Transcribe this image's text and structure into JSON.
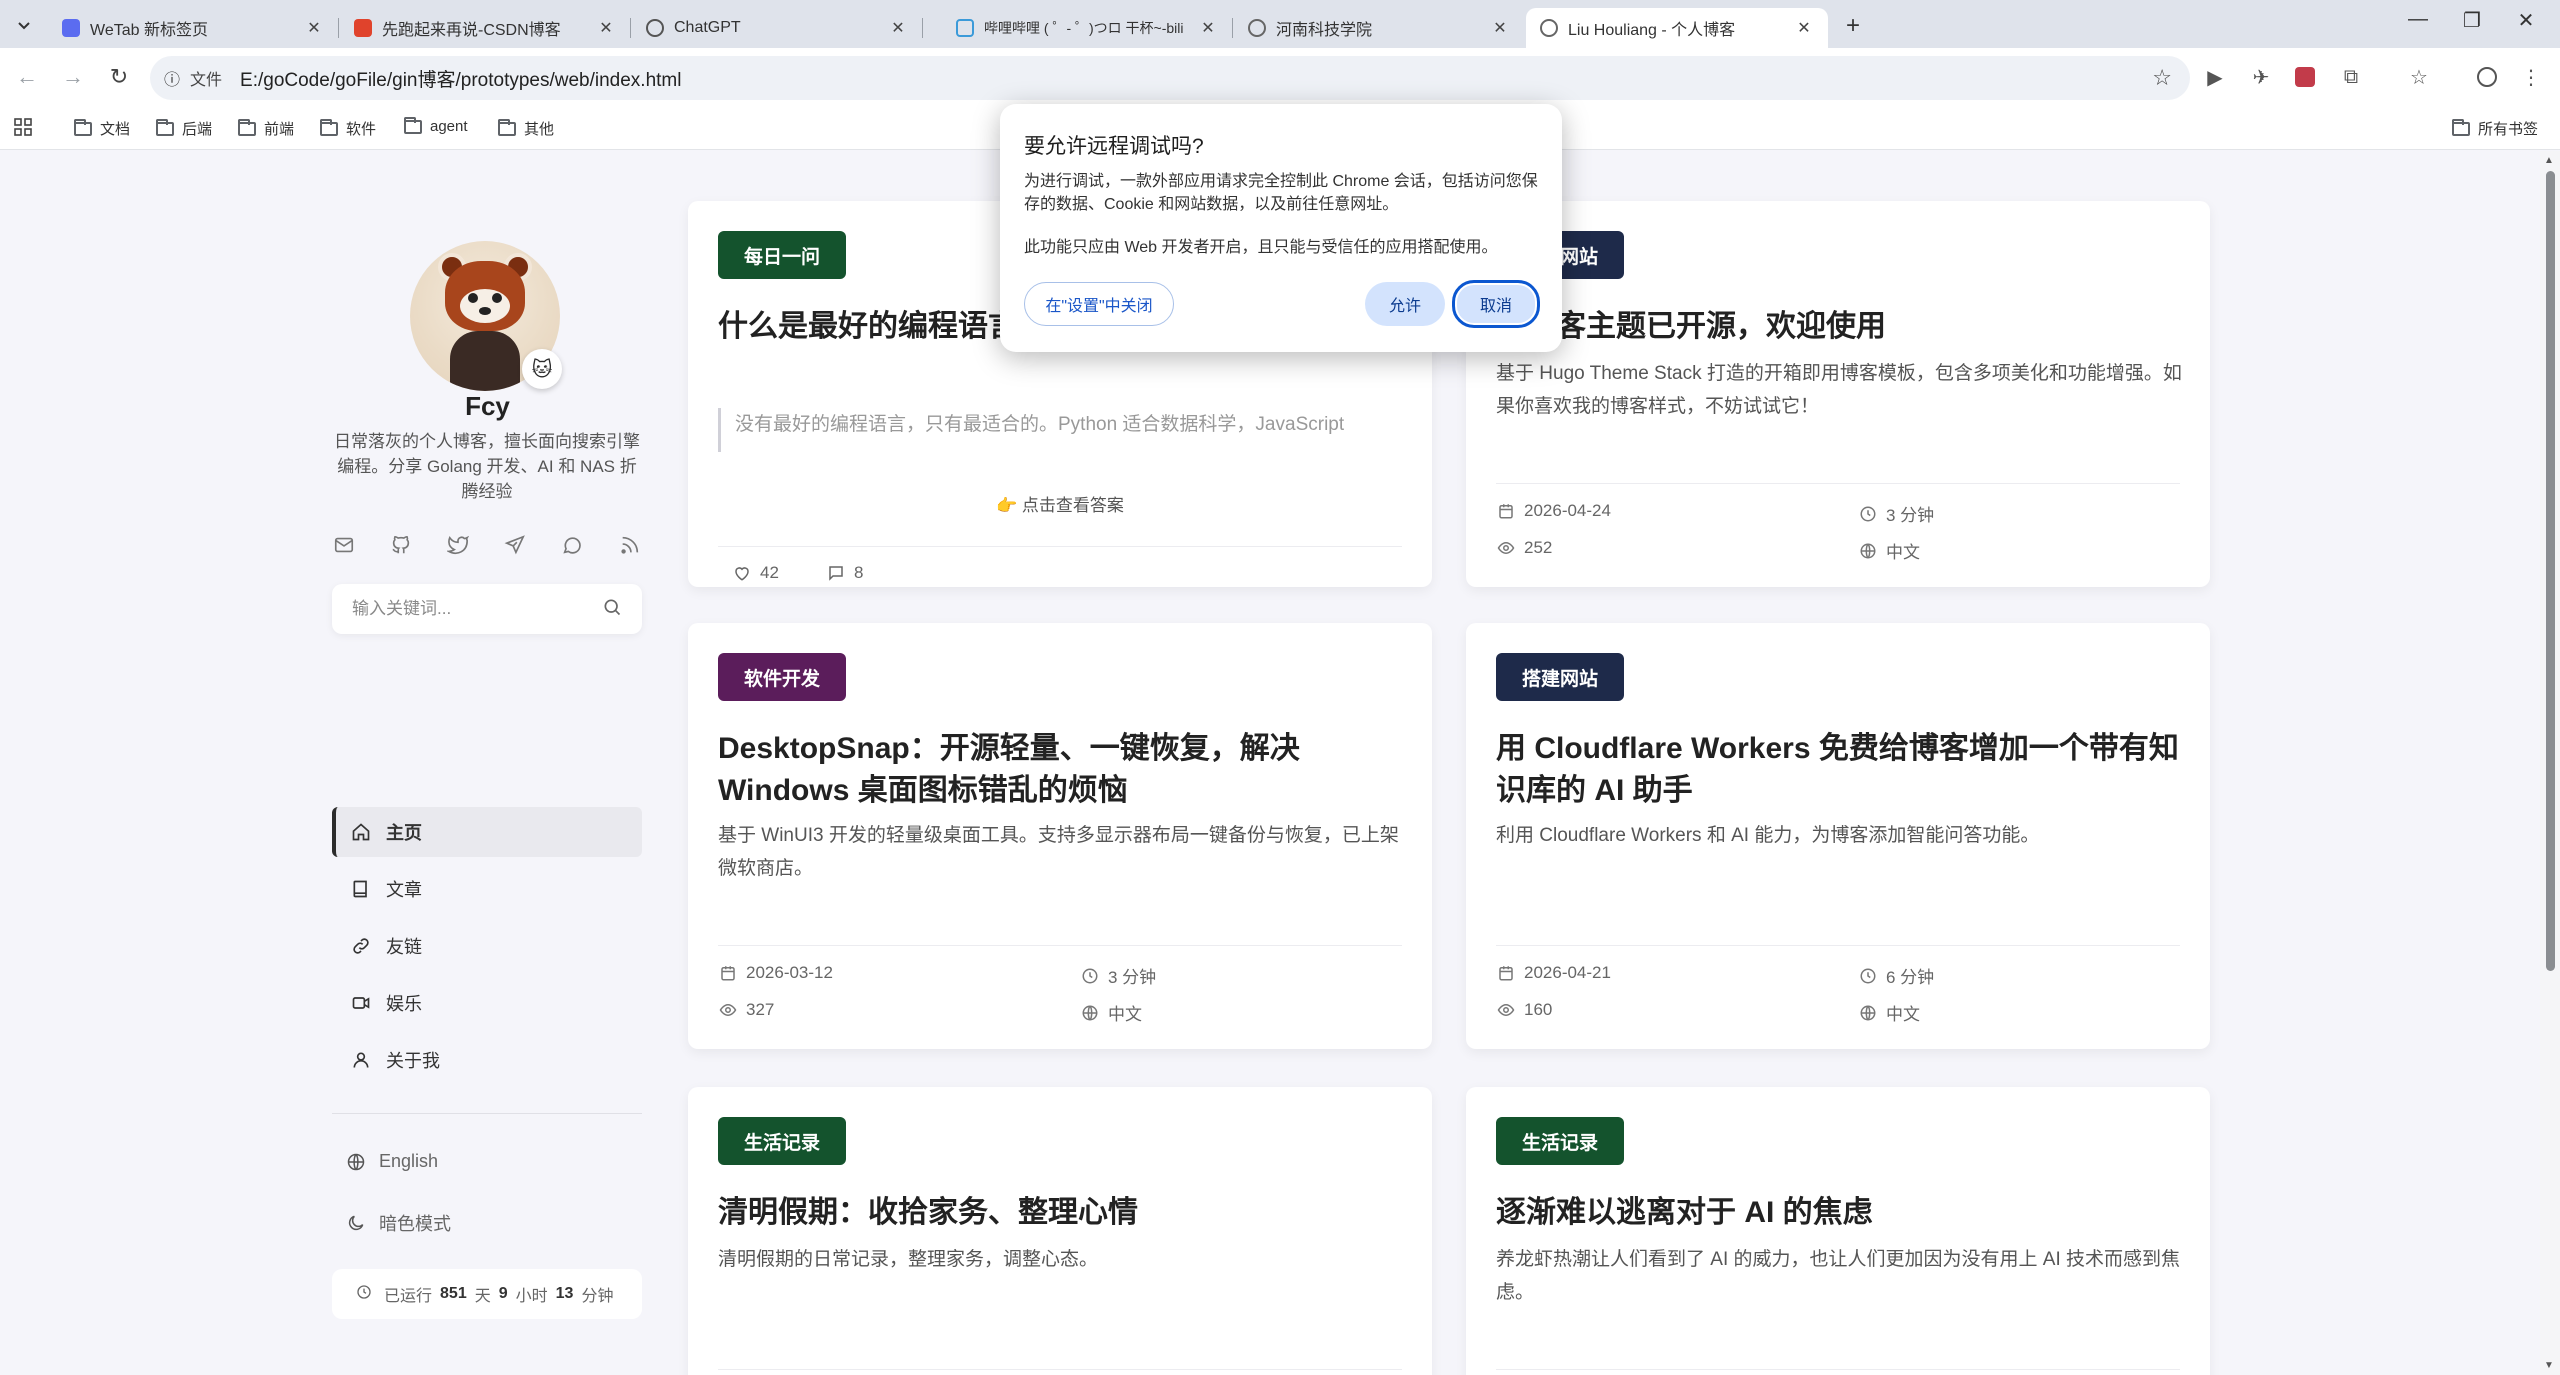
{
  "browser": {
    "tabs": [
      {
        "title": "WeTab 新标签页",
        "color": "#5b6cf0"
      },
      {
        "title": "先跑起来再说-CSDN博客",
        "color": "#e0432c"
      },
      {
        "title": "ChatGPT",
        "color": "#555555"
      },
      {
        "title": "哔哩哔哩 ( ゜- ゜)つロ 干杯~-bili",
        "color": "#3b9ad9"
      },
      {
        "title": "河南科技学院",
        "color": "#666666"
      },
      {
        "title": "Liu Houliang - 个人博客",
        "color": "#666666"
      }
    ],
    "url_chip": "文件",
    "url": "E:/goCode/goFile/gin博客/prototypes/web/index.html",
    "bookmarks": [
      "文档",
      "后端",
      "前端",
      "软件",
      "agent",
      "其他"
    ],
    "all_bookmarks": "所有书签"
  },
  "sidebar": {
    "name": "Fcy",
    "description": "日常落灰的个人博客，擅长面向搜索引擎编程。分享 Golang 开发、AI 和 NAS 折腾经验",
    "search_placeholder": "输入关键词...",
    "menu": [
      {
        "label": "主页",
        "icon": "home-icon"
      },
      {
        "label": "文章",
        "icon": "book-icon"
      },
      {
        "label": "友链",
        "icon": "link-icon"
      },
      {
        "label": "娱乐",
        "icon": "video-icon"
      },
      {
        "label": "关于我",
        "icon": "user-icon"
      }
    ],
    "language": "English",
    "dark_mode": "暗色模式",
    "runtime": {
      "prefix": "已运行",
      "days": "851",
      "days_unit": "天",
      "hours": "9",
      "hours_unit": "小时",
      "minutes": "13",
      "minutes_unit": "分钟"
    }
  },
  "cards": [
    {
      "tag": "每日一问",
      "tag_color": "#14532d",
      "title": "什么是最好的编程语言？",
      "excerpt": "没有最好的编程语言，只有最适合的。Python 适合数据科学，JavaScript",
      "reveal": "👉 点击查看答案",
      "likes": "42",
      "comments": "8"
    },
    {
      "tag": "搭建网站",
      "tag_color": "#1e2a4a",
      "title": "本博客主题已开源，欢迎使用",
      "excerpt": "基于 Hugo Theme Stack 打造的开箱即用博客模板，包含多项美化和功能增强。如果你喜欢我的博客样式，不妨试试它！",
      "date": "2026-04-24",
      "read_time": "3 分钟",
      "views": "252",
      "lang": "中文"
    },
    {
      "tag": "软件开发",
      "tag_color": "#5b1d5b",
      "title": "DesktopSnap：开源轻量、一键恢复，解决 Windows 桌面图标错乱的烦恼",
      "excerpt": "基于 WinUI3 开发的轻量级桌面工具。支持多显示器布局一键备份与恢复，已上架微软商店。",
      "date": "2026-03-12",
      "read_time": "3 分钟",
      "views": "327",
      "lang": "中文"
    },
    {
      "tag": "搭建网站",
      "tag_color": "#1e2a4a",
      "title": "用 Cloudflare Workers 免费给博客增加一个带有知识库的 AI 助手",
      "excerpt": "利用 Cloudflare Workers 和 AI 能力，为博客添加智能问答功能。",
      "date": "2026-04-21",
      "read_time": "6 分钟",
      "views": "160",
      "lang": "中文"
    },
    {
      "tag": "生活记录",
      "tag_color": "#14532d",
      "title": "清明假期：收拾家务、整理心情",
      "excerpt": "清明假期的日常记录，整理家务，调整心态。"
    },
    {
      "tag": "生活记录",
      "tag_color": "#14532d",
      "title": "逐渐难以逃离对于 AI 的焦虑",
      "excerpt": "养龙虾热潮让人们看到了 AI 的威力，也让人们更加因为没有用上 AI 技术而感到焦虑。"
    }
  ],
  "dialog": {
    "title": "要允许远程调试吗?",
    "body": "为进行调试，一款外部应用请求完全控制此 Chrome 会话，包括访问您保存的数据、Cookie 和网站数据，以及前往任意网址。",
    "body2": "此功能只应由 Web 开发者开启，且只能与受信任的应用搭配使用。",
    "settings_button": "在\"设置\"中关闭",
    "allow_button": "允许",
    "cancel_button": "取消"
  }
}
